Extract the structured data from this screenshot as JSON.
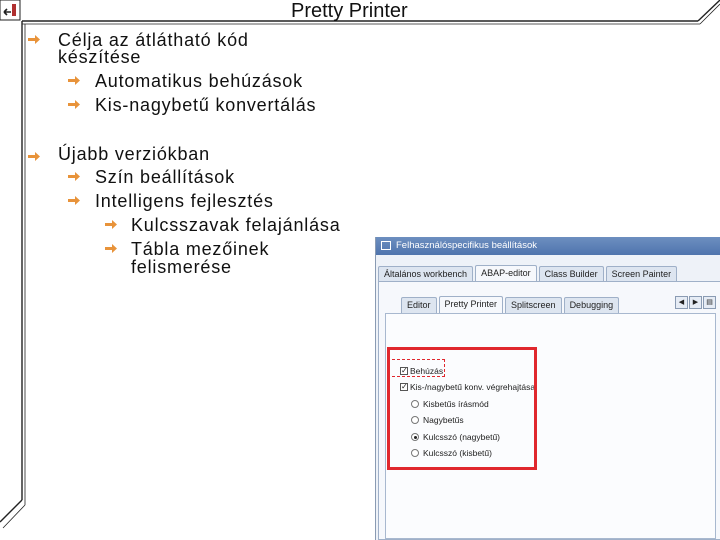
{
  "slide": {
    "title": "Pretty Printer",
    "bullets": [
      {
        "line1": "Célja az átlátható kód",
        "line2": "készítése"
      },
      {
        "text": "Automatikus behúzások"
      },
      {
        "text": "Kis-nagybetű konvertálás"
      },
      {
        "text": "Újabb verziókban"
      },
      {
        "text": "Szín beállítások"
      },
      {
        "text": "Intelligens fejlesztés"
      },
      {
        "text": "Kulcsszavak felajánlása"
      },
      {
        "line1": "Tábla mezőinek",
        "line2": "felismerése"
      }
    ]
  },
  "dialog": {
    "title": "Felhasználóspecifikus beállítások",
    "main_tabs": [
      "Általános workbench",
      "ABAP-editor",
      "Class Builder",
      "Screen Painter"
    ],
    "sub_tabs": [
      "Editor",
      "Pretty Printer",
      "Splitscreen",
      "Debugging"
    ],
    "options": {
      "indent": "Behúzás",
      "case_convert": "Kis-/nagybetű konv. végrehajtása",
      "r1": "Kisbetűs írásmód",
      "r2": "Nagybetűs",
      "r3": "Kulcsszó (nagybetű)",
      "r4": "Kulcsszó (kisbetű)"
    }
  },
  "colors": {
    "arrow": "#e8933a",
    "highlight": "#e0272d",
    "dialog_title": "#5a7db5"
  }
}
